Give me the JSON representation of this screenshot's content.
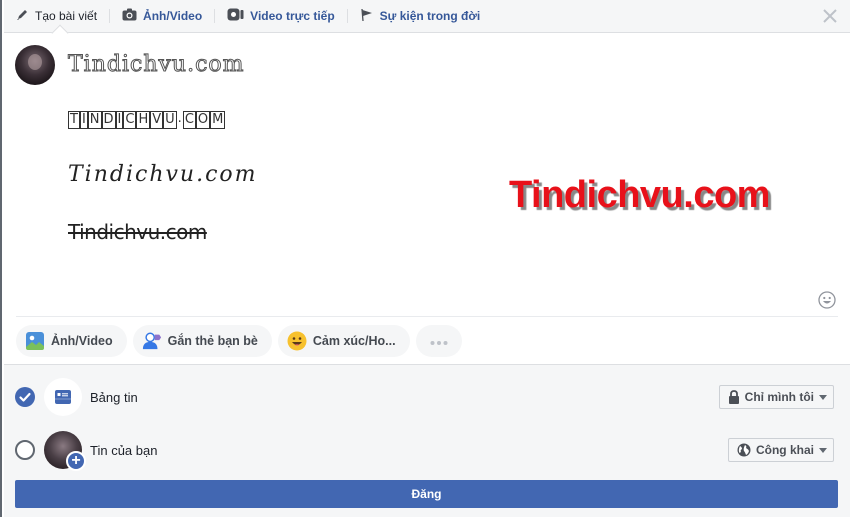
{
  "header": {
    "tabs": [
      {
        "label": "Tạo bài viết",
        "icon": "pencil-icon"
      },
      {
        "label": "Ảnh/Video",
        "icon": "camera-icon"
      },
      {
        "label": "Video trực tiếp",
        "icon": "video-camera-icon"
      },
      {
        "label": "Sự kiện trong đời",
        "icon": "flag-icon"
      }
    ],
    "close_icon": "close-icon"
  },
  "composer": {
    "lines": [
      "Tindichvu.com",
      [
        "T",
        "I",
        "N",
        "D",
        "I",
        "C",
        "H",
        "V",
        "U",
        ".",
        "C",
        "O",
        "M"
      ],
      "Tindichvu.com",
      "Tindichvu.com"
    ],
    "overlay_text": "Tindichvu.com",
    "overlay_color": "#e8111a",
    "emoji_icon": "smiley-icon"
  },
  "actions": [
    {
      "label": "Ảnh/Video",
      "icon": "photo-icon"
    },
    {
      "label": "Gắn thẻ bạn bè",
      "icon": "tag-friends-icon"
    },
    {
      "label": "Cảm xúc/Ho...",
      "icon": "feeling-emoji-icon"
    },
    {
      "label": "•••",
      "icon": "more-icon"
    }
  ],
  "destinations": [
    {
      "label": "Bảng tin",
      "checked": true,
      "privacy": "Chỉ mình tôi",
      "privacy_icon": "lock-icon"
    },
    {
      "label": "Tin của bạn",
      "checked": false,
      "privacy": "Công khai",
      "privacy_icon": "globe-icon"
    }
  ],
  "post_button": "Đăng",
  "colors": {
    "accent": "#4267b2",
    "link": "#365899",
    "panel_bg": "#f5f6f7"
  }
}
